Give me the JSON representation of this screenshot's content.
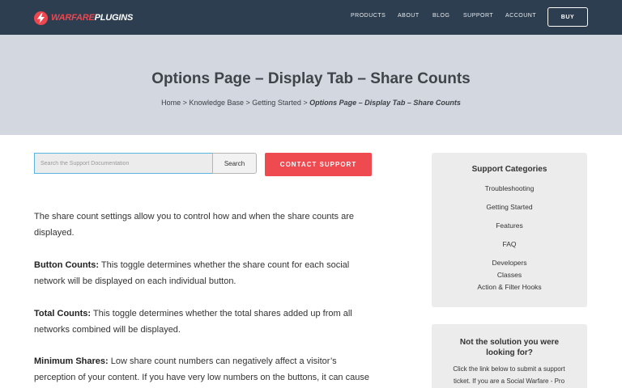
{
  "header": {
    "logo_word1": "WARFARE",
    "logo_word2": "PLUGINS",
    "nav": [
      "PRODUCTS",
      "ABOUT",
      "BLOG",
      "SUPPORT",
      "ACCOUNT"
    ],
    "buy_label": "BUY"
  },
  "hero": {
    "title": "Options Page – Display Tab – Share Counts",
    "breadcrumb": [
      "Home",
      "Knowledge Base",
      "Getting Started"
    ],
    "breadcrumb_current": "Options Page – Display Tab – Share Counts",
    "separator": ">"
  },
  "search": {
    "placeholder": "Search the Support Documentation",
    "button_label": "Search",
    "contact_label": "CONTACT SUPPORT"
  },
  "article": {
    "intro": "The share count settings allow you to control how and when the share counts are displayed.",
    "items": [
      {
        "term": "Button Counts:",
        "text": " This toggle determines whether the share count for each social network will be displayed on each individual button."
      },
      {
        "term": "Total Counts:",
        "text": " This toggle determines whether the total shares added up from all networks combined will be displayed."
      },
      {
        "term": "Minimum Shares:",
        "text": " Low share count numbers can negatively affect a visitor’s perception of your content. If you have very low numbers on the buttons, it can cause people to feel"
      }
    ]
  },
  "sidebar": {
    "categories_title": "Support Categories",
    "categories": [
      "Troubleshooting",
      "Getting Started",
      "Features",
      "FAQ",
      "Developers",
      "Classes",
      "Action & Filter Hooks"
    ],
    "cta_title": "Not the solution you were looking for?",
    "cta_text": "Click the link below to submit a support ticket. If you are a Social Warfare - Pro"
  },
  "colors": {
    "header_bg": "#2c3e50",
    "hero_bg": "#d3d7df",
    "accent": "#ef4a50",
    "sidebar_bg": "#ececec"
  }
}
